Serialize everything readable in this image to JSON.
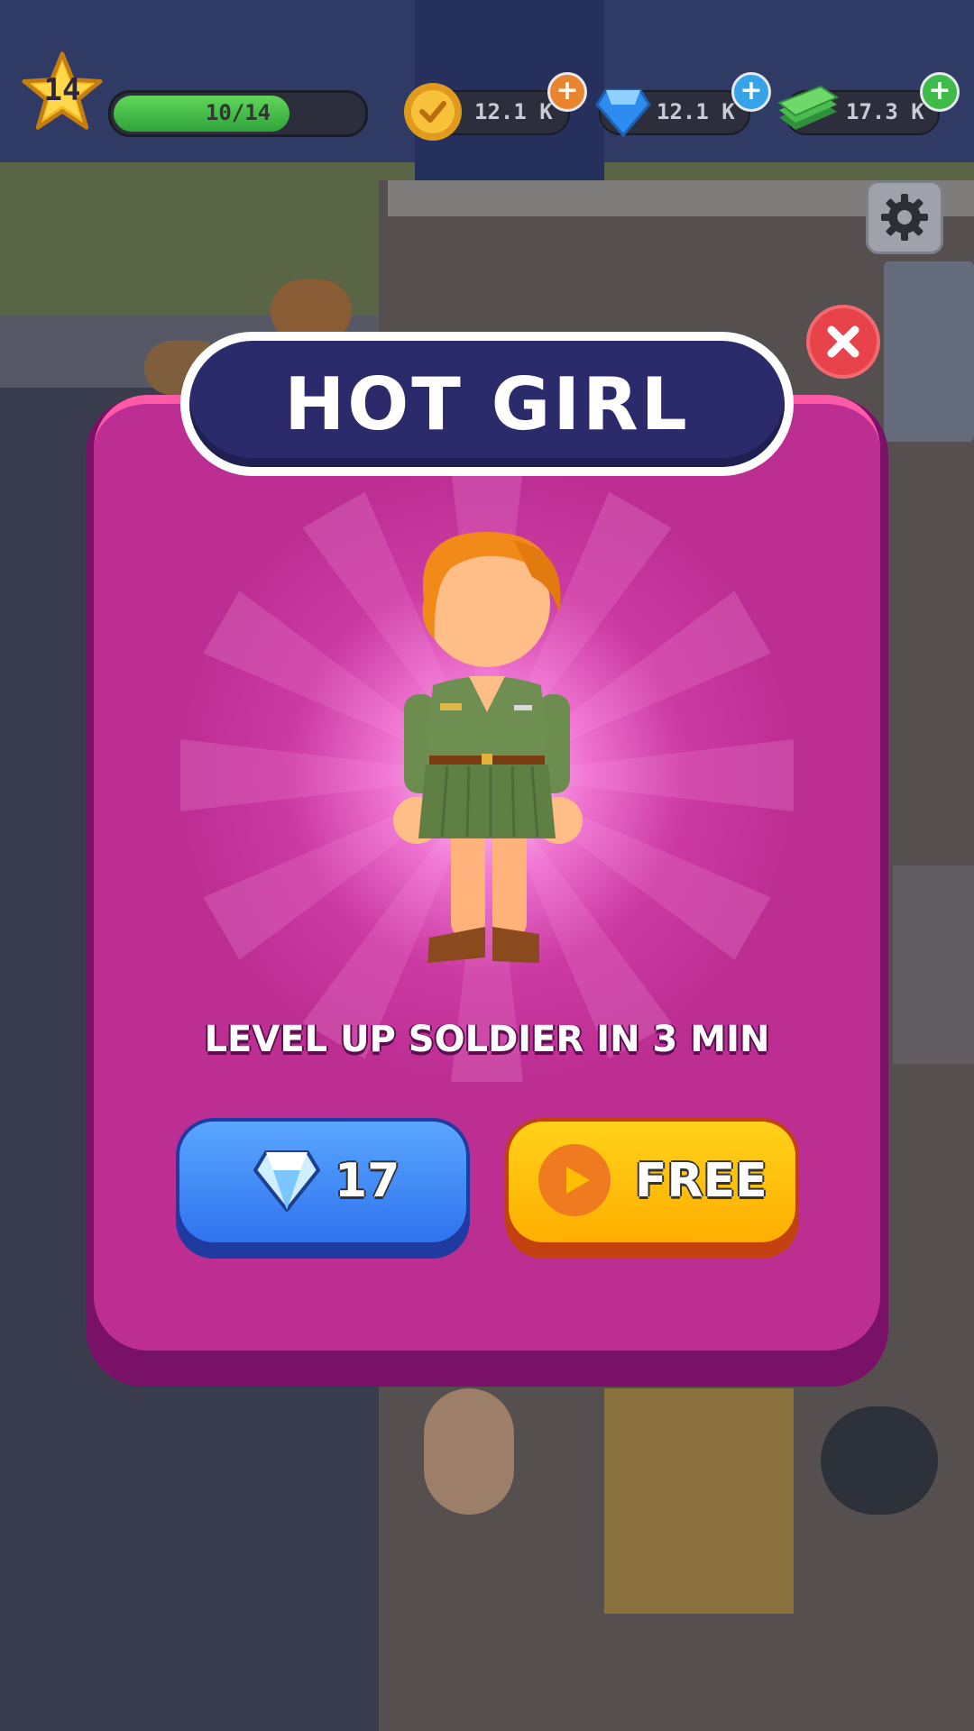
{
  "hud": {
    "level": "14",
    "xp_text": "10/14",
    "xp_progress": 0.714,
    "coins": "12.1 K",
    "gems": "12.1 K",
    "cash": "17.3 K",
    "icons": {
      "level": "star-icon",
      "coins": "coin-icon",
      "gems": "diamond-icon",
      "cash": "cash-stack-icon",
      "add": "plus-icon",
      "settings": "gear-icon"
    },
    "colors": {
      "xp": "#3bb143",
      "coin_plus": "#e9852f",
      "gem_plus": "#36a3e8",
      "cash_plus": "#3fbb4a"
    }
  },
  "modal": {
    "title": "HOT GIRL",
    "subtitle": "LEVEL UP SOLDIER IN 3 MIN",
    "close_icon": "close-icon",
    "character": "female-soldier-character",
    "buttons": {
      "gem_price": "17",
      "gem_icon": "diamond-icon",
      "free_label": "FREE",
      "free_icon": "play-video-icon"
    },
    "colors": {
      "panel": "#bd2e93",
      "title_plate": "#2b2a6b",
      "gem_button": "#3a86f6",
      "free_button": "#ffbf00"
    }
  }
}
